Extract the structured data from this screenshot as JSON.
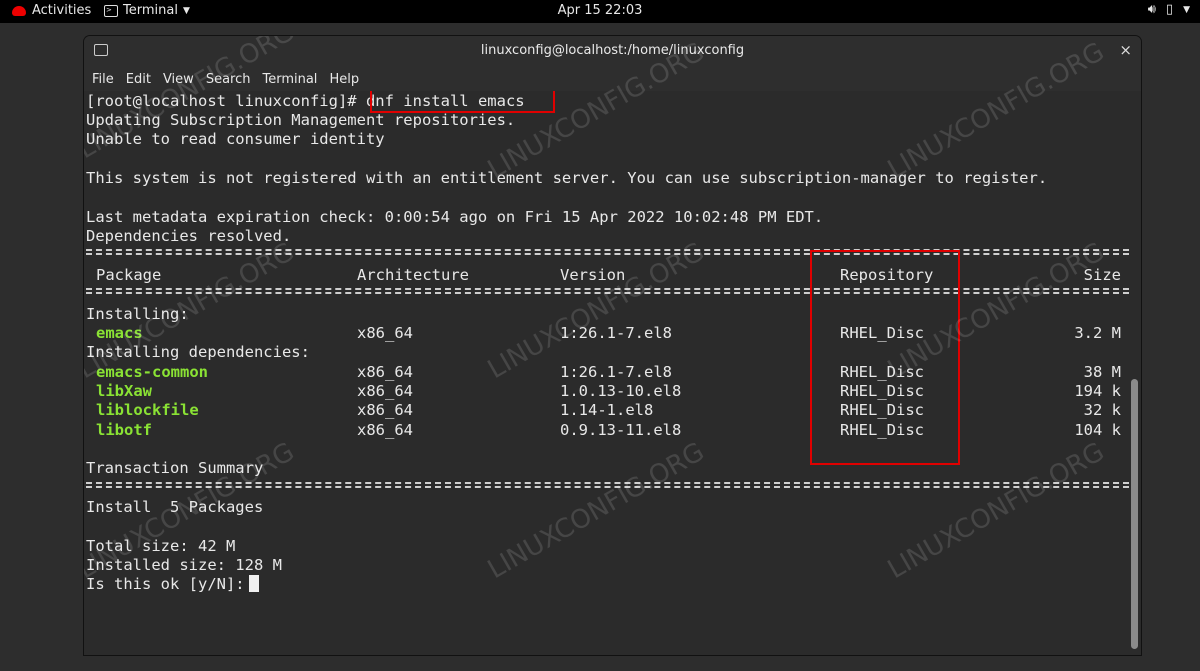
{
  "topbar": {
    "activities": "Activities",
    "app_name": "Terminal",
    "clock": "Apr 15  22:03"
  },
  "window": {
    "title": "linuxconfig@localhost:/home/linuxconfig",
    "close": "×"
  },
  "menu": [
    "File",
    "Edit",
    "View",
    "Search",
    "Terminal",
    "Help"
  ],
  "terminal": {
    "prompt": "[root@localhost linuxconfig]#",
    "command": "dnf install emacs",
    "l1": "Updating Subscription Management repositories.",
    "l2": "Unable to read consumer identity",
    "l3": "This system is not registered with an entitlement server. You can use subscription-manager to register.",
    "l4": "Last metadata expiration check: 0:00:54 ago on Fri 15 Apr 2022 10:02:48 PM EDT.",
    "l5": "Dependencies resolved.",
    "headers": {
      "package": "Package",
      "arch": "Architecture",
      "version": "Version",
      "repo": "Repository",
      "size": "Size"
    },
    "installing": "Installing:",
    "installing_deps": "Installing dependencies:",
    "packages": [
      {
        "name": "emacs",
        "arch": "x86_64",
        "version": "1:26.1-7.el8",
        "repo": "RHEL_Disc",
        "size": "3.2 M"
      },
      {
        "name": "emacs-common",
        "arch": "x86_64",
        "version": "1:26.1-7.el8",
        "repo": "RHEL_Disc",
        "size": "38 M"
      },
      {
        "name": "libXaw",
        "arch": "x86_64",
        "version": "1.0.13-10.el8",
        "repo": "RHEL_Disc",
        "size": "194 k"
      },
      {
        "name": "liblockfile",
        "arch": "x86_64",
        "version": "1.14-1.el8",
        "repo": "RHEL_Disc",
        "size": "32 k"
      },
      {
        "name": "libotf",
        "arch": "x86_64",
        "version": "0.9.13-11.el8",
        "repo": "RHEL_Disc",
        "size": "104 k"
      }
    ],
    "summary": "Transaction Summary",
    "install_line": "Install  5 Packages",
    "total_size": "Total size: 42 M",
    "installed_size": "Installed size: 128 M",
    "confirm": "Is this ok [y/N]:"
  },
  "watermark": "LINUXCONFIG.ORG",
  "colors": {
    "highlight": "#e00000",
    "package_green": "#8ae234",
    "terminal_bg": "#2b2b2b"
  }
}
